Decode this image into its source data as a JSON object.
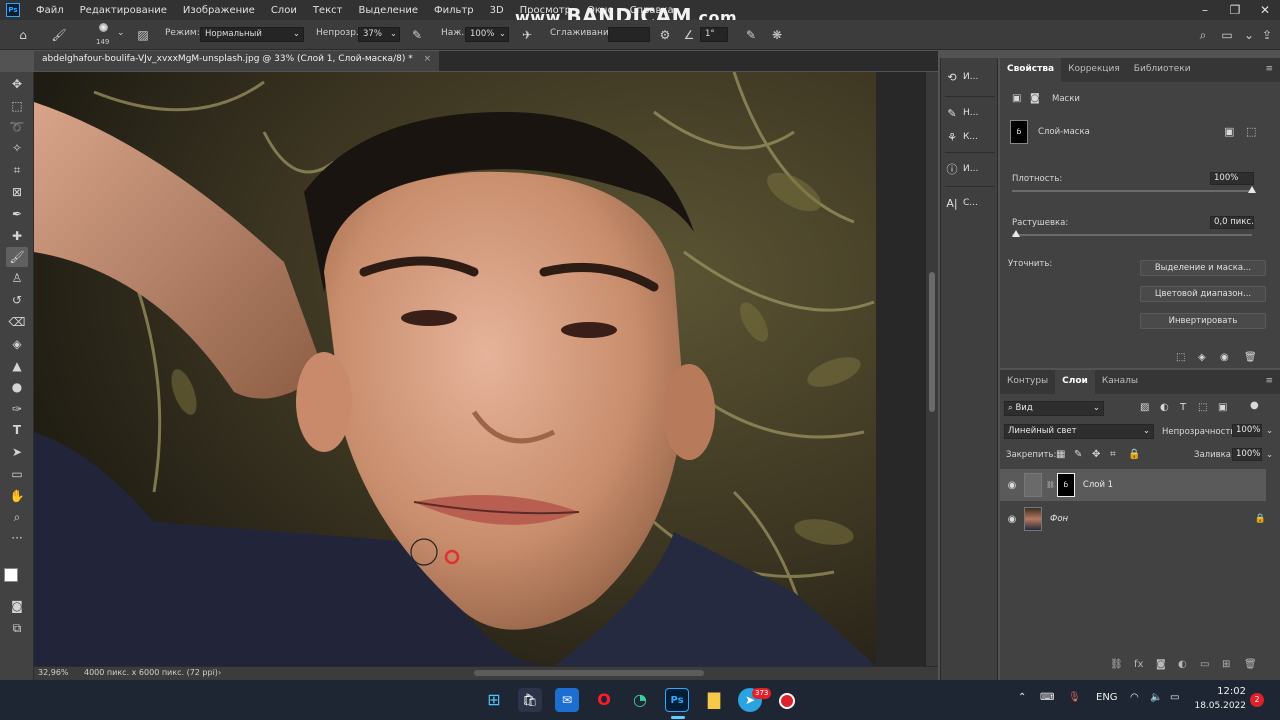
{
  "menu": {
    "logo": "Ps",
    "items": [
      "Файл",
      "Редактирование",
      "Изображение",
      "Слои",
      "Текст",
      "Выделение",
      "Фильтр",
      "3D",
      "Просмотр",
      "Окно",
      "Справка"
    ]
  },
  "watermark": {
    "prefix": "www.",
    "brand": "BANDICAM",
    "suffix": ".com"
  },
  "options": {
    "brush_size": "149",
    "mode_label": "Режим:",
    "mode_value": "Нормальный",
    "opacity_label": "Непрозр.:",
    "opacity_value": "37%",
    "pressure_label": "Наж.:",
    "pressure_value": "100%",
    "smoothing_label": "Сглаживание:",
    "angle_value": "1°"
  },
  "document": {
    "tab_title": "abdelghafour-boulifa-VJv_xvxxMgM-unsplash.jpg @ 33% (Слой 1, Слой-маска/8) *",
    "close_glyph": "×",
    "zoom": "32,96%",
    "info": "4000 пикс. x 6000 пикс. (72 ppi)"
  },
  "icon_column": [
    {
      "icon": "history-icon",
      "label": "И..."
    },
    {
      "icon": "brush-settings-icon",
      "label": "Н..."
    },
    {
      "icon": "clone-source-icon",
      "label": "К..."
    },
    {
      "icon": "info-icon",
      "label": "И..."
    },
    {
      "icon": "character-icon",
      "label": "С..."
    }
  ],
  "properties": {
    "tabs": [
      "Свойства",
      "Коррекция",
      "Библиотеки"
    ],
    "section": "Маски",
    "mask_name": "Слой-маска",
    "density_label": "Плотность:",
    "density_value": "100%",
    "density_fraction": 1.0,
    "feather_label": "Растушевка:",
    "feather_value": "0,0 пикс.",
    "feather_fraction": 0.0,
    "refine_label": "Уточнить:",
    "buttons": [
      "Выделение и маска...",
      "Цветовой диапазон...",
      "Инвертировать"
    ]
  },
  "layers": {
    "tabs": [
      "Контуры",
      "Слои",
      "Каналы"
    ],
    "filter_kind": "Вид",
    "blend_mode": "Линейный свет",
    "opacity_label": "Непрозрачность:",
    "opacity_value": "100%",
    "lock_label": "Закрепить:",
    "fill_label": "Заливка:",
    "fill_value": "100%",
    "items": [
      {
        "name": "Слой 1",
        "visible": true,
        "selected": true,
        "has_mask": true
      },
      {
        "name": "Фон",
        "visible": true,
        "selected": false,
        "locked": true
      }
    ]
  },
  "taskbar": {
    "telegram_badge": "373",
    "language": "ENG",
    "time": "12:02",
    "date": "18.05.2022",
    "notifications": "2"
  },
  "colors": {
    "accent": "#31a8ff",
    "record": "#e0202a"
  }
}
